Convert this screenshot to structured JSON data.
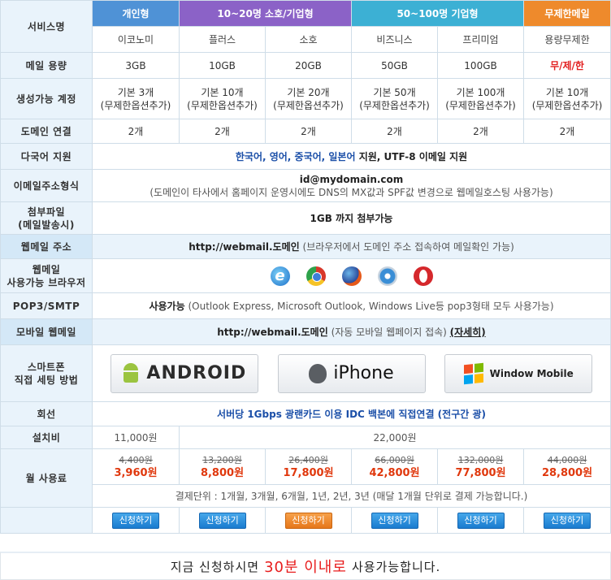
{
  "header": {
    "service_label": "서비스명",
    "groups": [
      "개인형",
      "10~20명 소호/기업형",
      "50~100명 기업형",
      "무제한메일"
    ],
    "plans": [
      "이코노미",
      "플러스",
      "소호",
      "비즈니스",
      "프리미엄",
      "용량무제한"
    ]
  },
  "rows": {
    "capacity": {
      "label": "메일 용량",
      "values": [
        "3GB",
        "10GB",
        "20GB",
        "50GB",
        "100GB",
        "무/제/한"
      ]
    },
    "accounts": {
      "label": "생성가능 계정",
      "values": [
        "기본 3개",
        "기본 10개",
        "기본 20개",
        "기본 50개",
        "기본 100개",
        "기본 10개"
      ],
      "note": "(무제한옵션추가)"
    },
    "domain": {
      "label": "도메인 연결",
      "values": [
        "2개",
        "2개",
        "2개",
        "2개",
        "2개",
        "2개"
      ]
    },
    "multilang": {
      "label": "다국어 지원",
      "highlight": "한국어, 영어, 중국어, 일본어",
      "rest": " 지원, UTF-8 이메일 지원"
    },
    "email_format": {
      "label": "이메일주소형식",
      "line1": "id@mydomain.com",
      "line2": "(도메인이 타사에서 홈페이지 운영시에도 DNS의 MX값과 SPF값 변경으로 웹메일호스팅 사용가능)"
    },
    "attachment": {
      "label_line1": "첨부파일",
      "label_line2": "(메일발송시)",
      "value": "1GB 까지 첨부가능"
    },
    "webmail_addr": {
      "label": "웹메일 주소",
      "url": "http://webmail.도메인",
      "desc": " (브라우저에서 도메인 주소 접속하여 메일확인 가능)"
    },
    "browsers": {
      "label_line1": "웹메일",
      "label_line2": "사용가능 브라우저",
      "items": [
        "ie-icon",
        "chrome-icon",
        "firefox-icon",
        "safari-icon",
        "opera-icon"
      ]
    },
    "pop3": {
      "label": "POP3/SMTP",
      "bold": "사용가능",
      "desc": " (Outlook Express, Microsoft Outlook, Windows Live등 pop3형태 모두 사용가능)"
    },
    "mobile": {
      "label": "모바일 웹메일",
      "url": "http://webmail.도메인",
      "desc": " (자동 모바일 웹페이지 접속) ",
      "link": "(자세히)"
    },
    "smartphone": {
      "label_line1": "스마트폰",
      "label_line2": "직접 세팅 방법",
      "buttons": [
        "ANDROID",
        "iPhone",
        "Window Mobile"
      ]
    },
    "line": {
      "label": "회선",
      "value": "서버당 1Gbps 광랜카드 이용 IDC 백본에 직접연결 (전구간 광)"
    },
    "setup": {
      "label": "설치비",
      "economy": "11,000원",
      "others": "22,000원"
    },
    "monthly": {
      "label": "월 사용료",
      "old": [
        "4,400원",
        "13,200원",
        "26,400원",
        "66,000원",
        "132,000원",
        "44,000원"
      ],
      "new": [
        "3,960원",
        "8,800원",
        "17,800원",
        "42,800원",
        "77,800원",
        "28,800원"
      ],
      "billing": "결제단위 : 1개월, 3개월, 6개월, 1년, 2년, 3년 (매달 1개월 단위로 결제 가능합니다.)"
    },
    "apply": {
      "label": "신청하기"
    }
  },
  "bottom": {
    "pre": "지금 신청하시면 ",
    "highlight": "30분 이내로",
    "post": " 사용가능합니다."
  },
  "colors": {
    "personal": "#4f92d6",
    "soho": "#8b62c7",
    "enterprise": "#3cb0d4",
    "unlimited": "#ee8a2c",
    "label_bg": "#e9f3fb"
  }
}
